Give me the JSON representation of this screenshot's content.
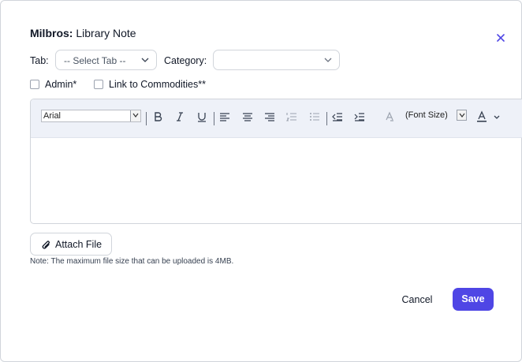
{
  "dialog": {
    "title_brand": "Milbros:",
    "title_text": " Library Note"
  },
  "form": {
    "tab_label": "Tab:",
    "tab_value": "-- Select Tab --",
    "category_label": "Category:",
    "category_value": "",
    "admin_label": "Admin*",
    "admin_checked": false,
    "commodities_label": "Link to Commodities**",
    "commodities_checked": false
  },
  "editor": {
    "font_family_value": "Arial",
    "font_size_value": "(Font Size)",
    "toolbar_icons": [
      "bold-icon",
      "italic-icon",
      "underline-icon",
      "align-left-icon",
      "align-center-icon",
      "align-right-icon",
      "ordered-list-icon",
      "unordered-list-icon",
      "outdent-icon",
      "indent-icon",
      "clear-format-icon",
      "font-color-icon"
    ],
    "content": ""
  },
  "attachment": {
    "button_label": "Attach File",
    "note": "Note: The maximum file size that can be uploaded is 4MB."
  },
  "actions": {
    "cancel_label": "Cancel",
    "save_label": "Save"
  },
  "colors": {
    "accent": "#4f46e5",
    "toolbar_bg": "#eef1f8",
    "border": "#d1d5db"
  }
}
